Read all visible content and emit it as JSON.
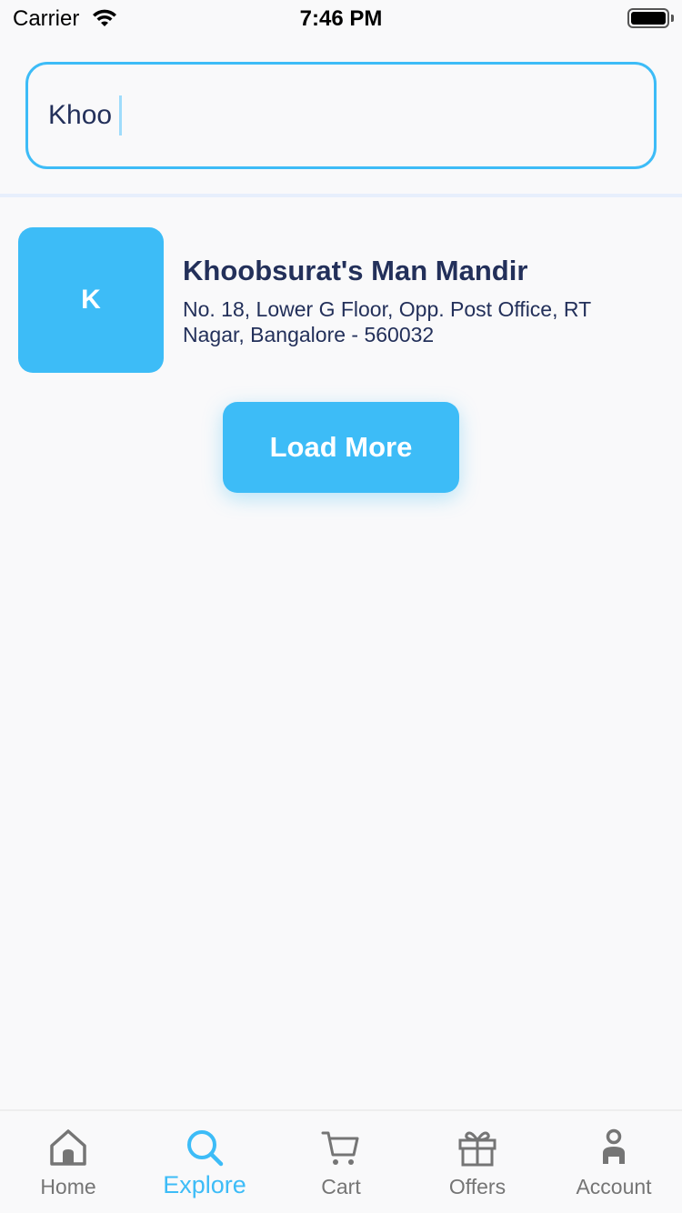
{
  "status_bar": {
    "carrier": "Carrier",
    "time": "7:46 PM"
  },
  "search": {
    "value": "Khoo",
    "accent_color": "#3dbcf7"
  },
  "results": [
    {
      "initial": "K",
      "title": "Khoobsurat's Man Mandir",
      "address": "No. 18, Lower G Floor, Opp. Post Office, RT Nagar, Bangalore - 560032"
    }
  ],
  "load_more_label": "Load More",
  "tab_bar": {
    "active": "Explore",
    "tabs": [
      {
        "label": "Home",
        "icon": "home-icon"
      },
      {
        "label": "Explore",
        "icon": "search-icon"
      },
      {
        "label": "Cart",
        "icon": "cart-icon"
      },
      {
        "label": "Offers",
        "icon": "gift-icon"
      },
      {
        "label": "Account",
        "icon": "person-icon"
      }
    ]
  },
  "colors": {
    "accent": "#3dbcf7",
    "text_primary": "#23305a",
    "tab_inactive": "#757575"
  }
}
